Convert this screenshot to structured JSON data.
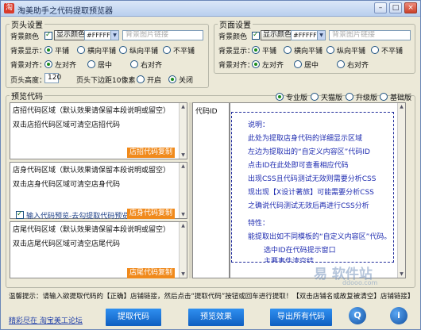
{
  "window": {
    "title": "淘美助手之代码提取预览器",
    "min": "–",
    "max": "□",
    "close": "×"
  },
  "header": {
    "legend": "页头设置",
    "bg_color_label": "背景颜色",
    "show_color_label": "显示颜色",
    "color_value": "#FFFFFF",
    "bg_image_placeholder": "背景图片链接",
    "bg_display_label": "背景显示：",
    "bg_display_options": [
      "平铺",
      "横向平铺",
      "纵向平铺",
      "不平铺"
    ],
    "bg_align_label": "背景对齐：",
    "bg_align_options": [
      "左对齐",
      "居中",
      "右对齐"
    ],
    "height_label": "页头高度：",
    "height_value": "120",
    "margin_label": "页头下边距10像素",
    "margin_options": [
      "开启",
      "关闭"
    ]
  },
  "footer": {
    "legend": "页面设置",
    "bg_color_label": "背景颜色",
    "show_color_label": "显示颜色",
    "color_value": "#FFFFFF",
    "bg_image_placeholder": "背景图片链接",
    "bg_display_label": "背景显示：",
    "bg_display_options": [
      "平铺",
      "横向平铺",
      "纵向平铺",
      "不平铺"
    ],
    "bg_align_label": "背景对齐：",
    "bg_align_options": [
      "左对齐",
      "居中",
      "右对齐"
    ]
  },
  "preview": {
    "legend": "预览代码",
    "versions": [
      "专业版",
      "天猫版",
      "升级版",
      "基础版"
    ],
    "sign_title": "店招代码区域（默认效果请保留本段说明或留空）",
    "sign_hint": "双击店招代码区域可清空店招代码",
    "sign_button": "店招代码复制",
    "body_title": "店身代码区域（默认效果请保留本段说明或留空）",
    "body_hint": "双击店身代码区域可清空店身代码",
    "input_preview_label": "输入代码预览-去勾提取代码预览",
    "body_button": "店身代码复制",
    "tail_title": "店尾代码区域（默认效果请保留本段说明或留空）",
    "tail_hint": "双击店尾代码区域可清空店尾代码",
    "tail_button": "店尾代码复制",
    "code_id_label": "代码ID"
  },
  "code_box": {
    "lines": [
      "说明：",
      "此处为提取店身代码的详细显示区域",
      "左边为提取出的“自定义内容区”代码ID",
      "点击ID在此处即可查看相应代码",
      "出现CSS且代码测试无效则需要分析CSS",
      "现出现【X设计著旅】可能需要分析CSS",
      "之确说代码测试无效后再进行CSS分析",
      "特性：",
      "能提取出如不同模板的“自定义内容区”代码。",
      "选中ID在代码提示窗口",
      "主要事件清空结"
    ]
  },
  "tip": {
    "text": "温馨提示：请输入欲提取代码的【正确】店铺链接，然后点击“提取代码”按钮或回车进行提取！【双击店铺名或故复被清空】店铺链接】"
  },
  "bottom": {
    "link": "精彩尽在 淘宝美工论坛",
    "extract_button": "提取代码",
    "preview_button": "预览效果",
    "export_button": "导出所有代码",
    "search_icon_glyph": "Q",
    "info_icon_glyph": "i"
  },
  "watermark": {
    "main": "易 软件站",
    "sub": "ddooo.com"
  },
  "colors": {
    "accent_orange": "#f08a1c",
    "blue_button": "#1670d8",
    "code_blue": "#1f2cb0"
  }
}
